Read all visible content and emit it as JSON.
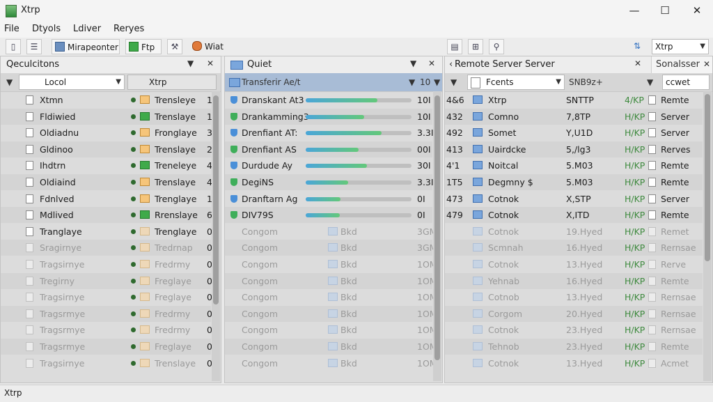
{
  "window": {
    "title": "Xtrp",
    "min": "—",
    "max": "☐",
    "close": "✕"
  },
  "menu": [
    "File",
    "Dtyols",
    "Ldiver",
    "Reryes"
  ],
  "toolbar": {
    "mirror_label": "Mirapeonter",
    "ftp_label": "Ftp",
    "wait_label": "Wiat",
    "right_combo": "Xtrp"
  },
  "colors": {
    "accent": "#6b8fbf",
    "progress_a": "#4aa6d8",
    "progress_b": "#63c87a",
    "folder": "#f6c57a",
    "green_folder": "#3faa4a"
  },
  "left": {
    "title": "Qeculcitons",
    "menu_glyph": "▼",
    "close_glyph": "✕",
    "col1": "Locol",
    "col2": "Xtrp",
    "rows": [
      {
        "name": "Xtmn",
        "status": "Trensleye",
        "n": "1"
      },
      {
        "name": "Fldiwied",
        "status": "Trenslaye",
        "n": "1"
      },
      {
        "name": "Oldiadnu",
        "status": "Fronglaye",
        "n": "3"
      },
      {
        "name": "Gldinoo",
        "status": "Trenslaye",
        "n": "2"
      },
      {
        "name": "Ihdtrn",
        "status": "Treneleye",
        "n": "4"
      },
      {
        "name": "Oldiaind",
        "status": "Trenslaye",
        "n": "4"
      },
      {
        "name": "Fdnlved",
        "status": "Trenglaye",
        "n": "1"
      },
      {
        "name": "Mdlived",
        "status": "Rrenslaye",
        "n": "6"
      },
      {
        "name": "Tranglaye",
        "status": "Trenglaye",
        "n": "0"
      },
      {
        "name": "Sragirnye",
        "status": "Tredrnap",
        "n": "0"
      },
      {
        "name": "Tragsirnye",
        "status": "Fredrmy",
        "n": "0"
      },
      {
        "name": "Tregirny",
        "status": "Freglaye",
        "n": "0"
      },
      {
        "name": "Tragsirnye",
        "status": "Freglaye",
        "n": "0"
      },
      {
        "name": "Tragsrmye",
        "status": "Fredrmy",
        "n": "0"
      },
      {
        "name": "Tragsrmye",
        "status": "Fredrmy",
        "n": "0"
      },
      {
        "name": "Tragsrmye",
        "status": "Freglaye",
        "n": "0"
      },
      {
        "name": "Tragsirnye",
        "status": "Trenslaye",
        "n": "0"
      }
    ]
  },
  "mid": {
    "title": "Quiet",
    "menu_glyph": "▼",
    "close_glyph": "✕",
    "col1": "Transferir Ae/t",
    "col2": "10",
    "rows": [
      {
        "name": "Dranskant At3",
        "pct": 0.68,
        "size": "10I"
      },
      {
        "name": "Drankamming3",
        "pct": 0.55,
        "size": "10I"
      },
      {
        "name": "Drenfiant AT:",
        "pct": 0.72,
        "size": "3.3I"
      },
      {
        "name": "Drenfiant AS",
        "pct": 0.5,
        "size": "00I"
      },
      {
        "name": "Durdude Ay",
        "pct": 0.58,
        "size": "30I"
      },
      {
        "name": "DegiNS",
        "pct": 0.4,
        "size": "3.3I"
      },
      {
        "name": "Dranftarn Ag",
        "pct": 0.33,
        "size": "0I"
      },
      {
        "name": "DIV79S",
        "pct": 0.32,
        "size": "0I"
      },
      {
        "name": "Congom",
        "pct": 0,
        "size": "3GM"
      },
      {
        "name": "Congom",
        "pct": 0,
        "size": "3GM"
      },
      {
        "name": "Congom",
        "pct": 0,
        "size": "1OM"
      },
      {
        "name": "Congom",
        "pct": 0,
        "size": "1OM"
      },
      {
        "name": "Congom",
        "pct": 0,
        "size": "1OM"
      },
      {
        "name": "Congom",
        "pct": 0,
        "size": "1OM"
      },
      {
        "name": "Congom",
        "pct": 0,
        "size": "1OM"
      },
      {
        "name": "Congom",
        "pct": 0,
        "size": "1OM"
      },
      {
        "name": "Congom",
        "pct": 0,
        "size": "1OM"
      }
    ],
    "faded_label": "Bkd"
  },
  "right": {
    "title": "Remote Server Server",
    "close_glyph": "✕",
    "col1": "Fcents",
    "col2": "SNB9z+",
    "col3": "ccwet",
    "rows": [
      {
        "id": "4&6",
        "name": "Xtrp",
        "size": "SNTTP",
        "flag": "4/KP",
        "type": "Remte"
      },
      {
        "id": "432",
        "name": "Comno",
        "size": "7,8TP",
        "flag": "H/KP",
        "type": "Server"
      },
      {
        "id": "492",
        "name": "Somet",
        "size": "Y,U1D",
        "flag": "H/KP",
        "type": "Server"
      },
      {
        "id": "413",
        "name": "Uairdcke",
        "size": "5,/lg3",
        "flag": "H/KP",
        "type": "Rerves"
      },
      {
        "id": "4'1",
        "name": "Noitcal",
        "size": "5.M03",
        "flag": "H/KP",
        "type": "Remte"
      },
      {
        "id": "1T5",
        "name": "Degmny $",
        "size": "5.M03",
        "flag": "H/KP",
        "type": "Remte"
      },
      {
        "id": "473",
        "name": "Cotnok",
        "size": "X,STP",
        "flag": "H/KP",
        "type": "Server"
      },
      {
        "id": "479",
        "name": "Cotnok",
        "size": "X,ITD",
        "flag": "H/KP",
        "type": "Remte"
      },
      {
        "id": "",
        "name": "Cotnok",
        "size": "19.Hyed",
        "flag": "H/KP",
        "type": "Remet"
      },
      {
        "id": "",
        "name": "Scmnah",
        "size": "16.Hyed",
        "flag": "H/KP",
        "type": "Rernsae"
      },
      {
        "id": "",
        "name": "Cotnok",
        "size": "13.Hyed",
        "flag": "H/KP",
        "type": "Rerve"
      },
      {
        "id": "",
        "name": "Yehnab",
        "size": "16.Hyed",
        "flag": "H/KP",
        "type": "Remte"
      },
      {
        "id": "",
        "name": "Cotnob",
        "size": "13.Hyed",
        "flag": "H/KP",
        "type": "Rernsae"
      },
      {
        "id": "",
        "name": "Corgom",
        "size": "20.Hyed",
        "flag": "H/KP",
        "type": "Rernsae"
      },
      {
        "id": "",
        "name": "Cotnok",
        "size": "23.Hyed",
        "flag": "H/KP",
        "type": "Rernsae"
      },
      {
        "id": "",
        "name": "Tehnob",
        "size": "23.Hyed",
        "flag": "H/KP",
        "type": "Remte"
      },
      {
        "id": "",
        "name": "Cotnok",
        "size": "13.Hyed",
        "flag": "H/KP",
        "type": "Acmet"
      }
    ]
  },
  "right_tab": {
    "title": "Sonalsser",
    "close_glyph": "✕"
  },
  "status": {
    "text": "Xtrp"
  }
}
